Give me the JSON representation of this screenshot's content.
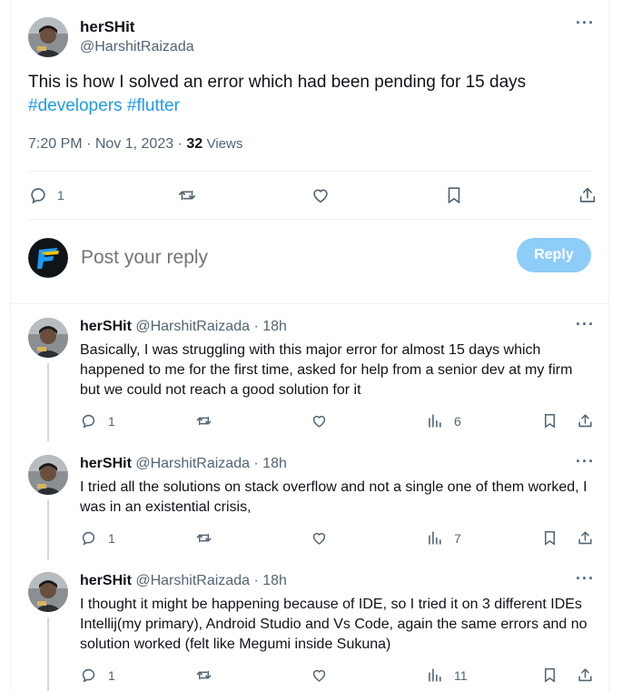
{
  "main_tweet": {
    "author_name": "herSHit",
    "author_handle": "@HarshitRaizada",
    "text": "This is how I solved an error which had been pending for 15 days",
    "hashtags": [
      "#developers",
      "#flutter"
    ],
    "time": "7:20 PM",
    "date": "Nov 1, 2023",
    "views_count": "32",
    "views_label": "Views",
    "reply_count": "1"
  },
  "reply_composer": {
    "placeholder": "Post your reply",
    "button_label": "Reply"
  },
  "replies": [
    {
      "author_name": "herSHit",
      "author_handle": "@HarshitRaizada",
      "age": "18h",
      "text": "Basically, I was struggling with this major error for almost 15 days which happened to me for the first time, asked for help from a senior dev at my firm but we could not reach a good solution for it",
      "reply_count": "1",
      "views": "6"
    },
    {
      "author_name": "herSHit",
      "author_handle": "@HarshitRaizada",
      "age": "18h",
      "text": "I tried all the solutions on stack overflow and not a single one of them worked, I was in an existential crisis,",
      "reply_count": "1",
      "views": "7"
    },
    {
      "author_name": "herSHit",
      "author_handle": "@HarshitRaizada",
      "age": "18h",
      "text": "I thought it might be happening because of IDE, so I tried it on 3 different IDEs Intellij(my primary), Android Studio and Vs Code, again the same errors and no solution worked (felt like Megumi inside Sukuna)",
      "reply_count": "1",
      "views": "11"
    }
  ],
  "icons": {
    "more": "more-dots-icon",
    "reply": "speech-bubble-icon",
    "repost": "repost-arrows-icon",
    "like": "heart-icon",
    "views": "bar-chart-icon",
    "bookmark": "bookmark-icon",
    "share": "share-upload-icon"
  },
  "colors": {
    "accent": "#1d9bf0",
    "reply_button": "#8ecdf8",
    "muted_text": "#536471",
    "border": "#eff3f4"
  }
}
